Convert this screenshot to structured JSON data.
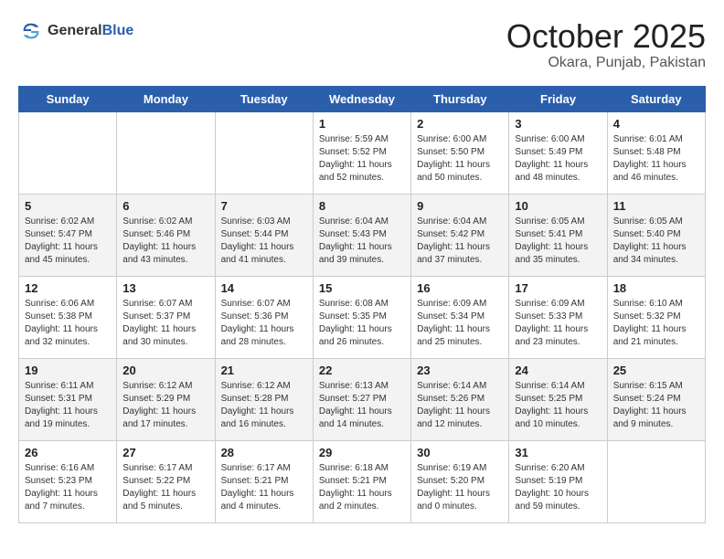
{
  "header": {
    "logo_general": "General",
    "logo_blue": "Blue",
    "title": "October 2025",
    "subtitle": "Okara, Punjab, Pakistan"
  },
  "days_of_week": [
    "Sunday",
    "Monday",
    "Tuesday",
    "Wednesday",
    "Thursday",
    "Friday",
    "Saturday"
  ],
  "weeks": [
    [
      {
        "day": "",
        "info": ""
      },
      {
        "day": "",
        "info": ""
      },
      {
        "day": "",
        "info": ""
      },
      {
        "day": "1",
        "info": "Sunrise: 5:59 AM\nSunset: 5:52 PM\nDaylight: 11 hours and 52 minutes."
      },
      {
        "day": "2",
        "info": "Sunrise: 6:00 AM\nSunset: 5:50 PM\nDaylight: 11 hours and 50 minutes."
      },
      {
        "day": "3",
        "info": "Sunrise: 6:00 AM\nSunset: 5:49 PM\nDaylight: 11 hours and 48 minutes."
      },
      {
        "day": "4",
        "info": "Sunrise: 6:01 AM\nSunset: 5:48 PM\nDaylight: 11 hours and 46 minutes."
      }
    ],
    [
      {
        "day": "5",
        "info": "Sunrise: 6:02 AM\nSunset: 5:47 PM\nDaylight: 11 hours and 45 minutes."
      },
      {
        "day": "6",
        "info": "Sunrise: 6:02 AM\nSunset: 5:46 PM\nDaylight: 11 hours and 43 minutes."
      },
      {
        "day": "7",
        "info": "Sunrise: 6:03 AM\nSunset: 5:44 PM\nDaylight: 11 hours and 41 minutes."
      },
      {
        "day": "8",
        "info": "Sunrise: 6:04 AM\nSunset: 5:43 PM\nDaylight: 11 hours and 39 minutes."
      },
      {
        "day": "9",
        "info": "Sunrise: 6:04 AM\nSunset: 5:42 PM\nDaylight: 11 hours and 37 minutes."
      },
      {
        "day": "10",
        "info": "Sunrise: 6:05 AM\nSunset: 5:41 PM\nDaylight: 11 hours and 35 minutes."
      },
      {
        "day": "11",
        "info": "Sunrise: 6:05 AM\nSunset: 5:40 PM\nDaylight: 11 hours and 34 minutes."
      }
    ],
    [
      {
        "day": "12",
        "info": "Sunrise: 6:06 AM\nSunset: 5:38 PM\nDaylight: 11 hours and 32 minutes."
      },
      {
        "day": "13",
        "info": "Sunrise: 6:07 AM\nSunset: 5:37 PM\nDaylight: 11 hours and 30 minutes."
      },
      {
        "day": "14",
        "info": "Sunrise: 6:07 AM\nSunset: 5:36 PM\nDaylight: 11 hours and 28 minutes."
      },
      {
        "day": "15",
        "info": "Sunrise: 6:08 AM\nSunset: 5:35 PM\nDaylight: 11 hours and 26 minutes."
      },
      {
        "day": "16",
        "info": "Sunrise: 6:09 AM\nSunset: 5:34 PM\nDaylight: 11 hours and 25 minutes."
      },
      {
        "day": "17",
        "info": "Sunrise: 6:09 AM\nSunset: 5:33 PM\nDaylight: 11 hours and 23 minutes."
      },
      {
        "day": "18",
        "info": "Sunrise: 6:10 AM\nSunset: 5:32 PM\nDaylight: 11 hours and 21 minutes."
      }
    ],
    [
      {
        "day": "19",
        "info": "Sunrise: 6:11 AM\nSunset: 5:31 PM\nDaylight: 11 hours and 19 minutes."
      },
      {
        "day": "20",
        "info": "Sunrise: 6:12 AM\nSunset: 5:29 PM\nDaylight: 11 hours and 17 minutes."
      },
      {
        "day": "21",
        "info": "Sunrise: 6:12 AM\nSunset: 5:28 PM\nDaylight: 11 hours and 16 minutes."
      },
      {
        "day": "22",
        "info": "Sunrise: 6:13 AM\nSunset: 5:27 PM\nDaylight: 11 hours and 14 minutes."
      },
      {
        "day": "23",
        "info": "Sunrise: 6:14 AM\nSunset: 5:26 PM\nDaylight: 11 hours and 12 minutes."
      },
      {
        "day": "24",
        "info": "Sunrise: 6:14 AM\nSunset: 5:25 PM\nDaylight: 11 hours and 10 minutes."
      },
      {
        "day": "25",
        "info": "Sunrise: 6:15 AM\nSunset: 5:24 PM\nDaylight: 11 hours and 9 minutes."
      }
    ],
    [
      {
        "day": "26",
        "info": "Sunrise: 6:16 AM\nSunset: 5:23 PM\nDaylight: 11 hours and 7 minutes."
      },
      {
        "day": "27",
        "info": "Sunrise: 6:17 AM\nSunset: 5:22 PM\nDaylight: 11 hours and 5 minutes."
      },
      {
        "day": "28",
        "info": "Sunrise: 6:17 AM\nSunset: 5:21 PM\nDaylight: 11 hours and 4 minutes."
      },
      {
        "day": "29",
        "info": "Sunrise: 6:18 AM\nSunset: 5:21 PM\nDaylight: 11 hours and 2 minutes."
      },
      {
        "day": "30",
        "info": "Sunrise: 6:19 AM\nSunset: 5:20 PM\nDaylight: 11 hours and 0 minutes."
      },
      {
        "day": "31",
        "info": "Sunrise: 6:20 AM\nSunset: 5:19 PM\nDaylight: 10 hours and 59 minutes."
      },
      {
        "day": "",
        "info": ""
      }
    ]
  ]
}
